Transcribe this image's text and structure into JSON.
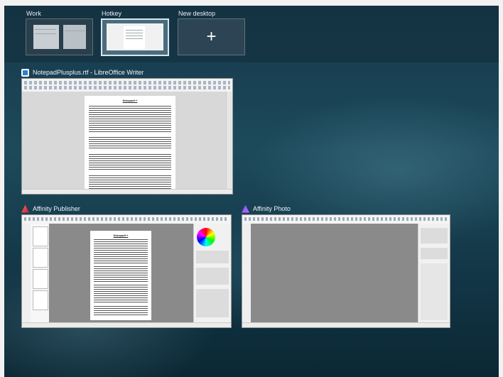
{
  "desktops": [
    {
      "label": "Work",
      "active": false
    },
    {
      "label": "Hotkey",
      "active": true
    },
    {
      "label": "New desktop",
      "plus": "+"
    }
  ],
  "windows": [
    {
      "title": "NotepadPlusplus.rtf - LibreOffice Writer",
      "icon": "libreoffice-writer-icon",
      "doc_heading": "Notepad++"
    },
    {
      "title": "Affinity Publisher",
      "icon": "affinity-publisher-icon",
      "doc_heading": "Notepad++"
    },
    {
      "title": "Affinity Photo",
      "icon": "affinity-photo-icon"
    }
  ],
  "colors": {
    "writer_accent": "#2a7fd6",
    "publisher_accent": "#e0442e",
    "photo_accent": "#8b5cff"
  }
}
